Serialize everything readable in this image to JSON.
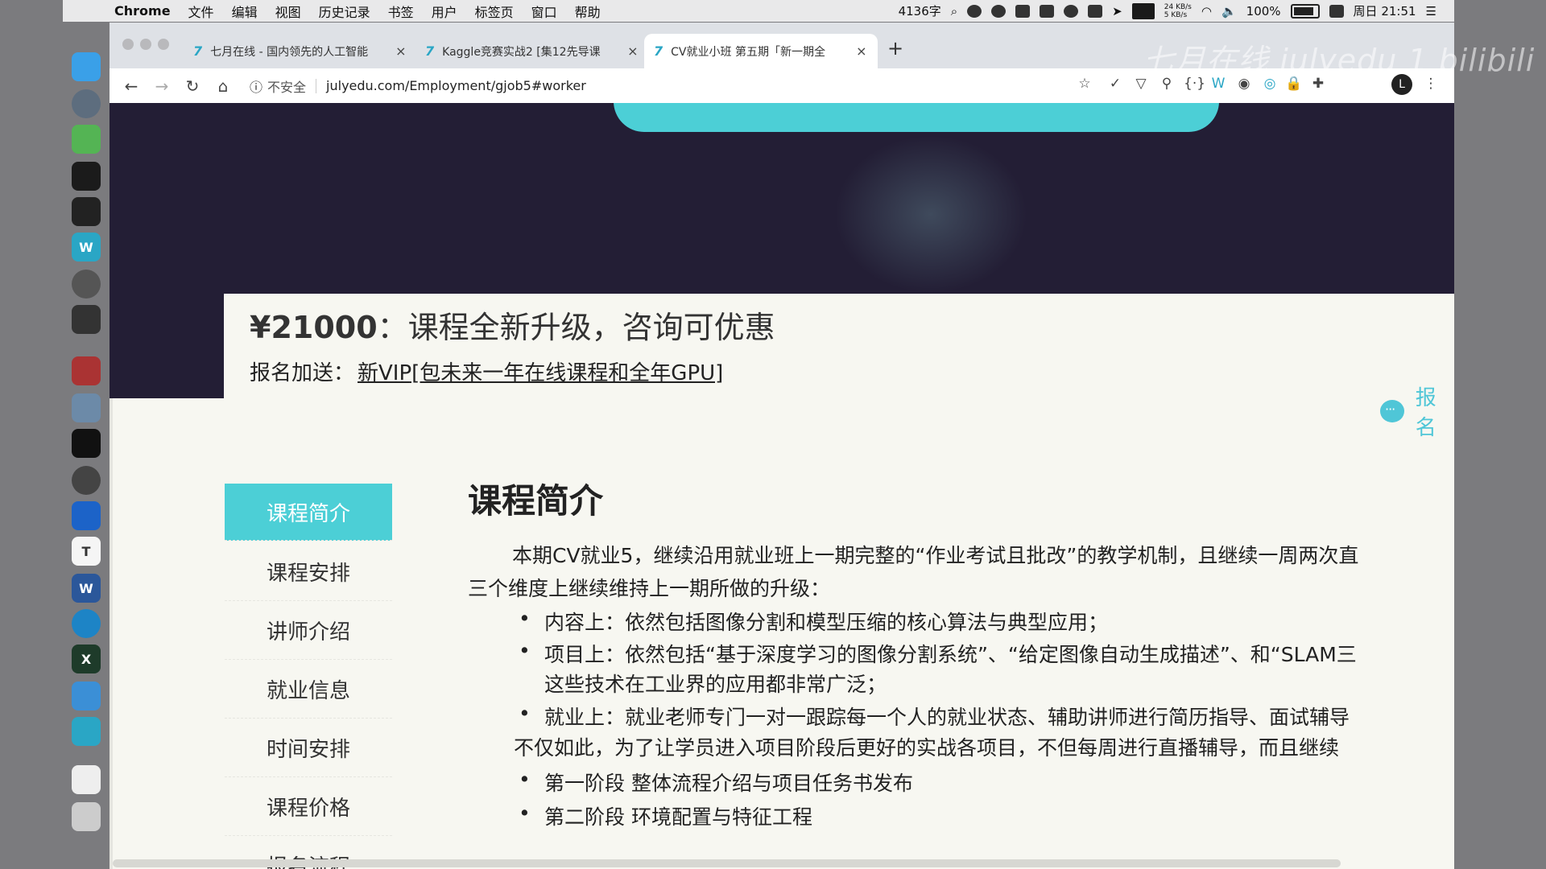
{
  "menubar": {
    "items": [
      "Chrome",
      "文件",
      "编辑",
      "视图",
      "历史记录",
      "书签",
      "用户",
      "标签页",
      "窗口",
      "帮助"
    ],
    "word_count": "4136字",
    "net_up": "24 KB/s",
    "net_down": "5 KB/s",
    "battery": "100%",
    "clock": "周日 21:51"
  },
  "tabs": [
    {
      "title": "七月在线 - 国内领先的人工智能",
      "active": false
    },
    {
      "title": "Kaggle竞赛实战2 [集12先导课",
      "active": false
    },
    {
      "title": "CV就业小班 第五期「新一期全",
      "active": true
    }
  ],
  "toolbar": {
    "security_label": "不安全",
    "url": "julyedu.com/Employment/gjob5#worker",
    "profile_initial": "L"
  },
  "watermark": "七月在线 julyedu 1 bilibili",
  "page": {
    "price": "¥21000",
    "price_desc": "：课程全新升级，咨询可优惠",
    "bonus_label": "报名加送：",
    "bonus_link": "新VIP[包未来一年在线课程和全年GPU]",
    "signup_label": "报名",
    "sidenav": [
      "课程简介",
      "课程安排",
      "讲师介绍",
      "就业信息",
      "时间安排",
      "课程价格",
      "报名流程"
    ],
    "section_title": "课程简介",
    "intro_line1": "本期CV就业5，继续沿用就业班上一期完整的“作业考试且批改”的教学机制，且继续一周两次直",
    "intro_line2": "三个维度上继续维持上一期所做的升级：",
    "bullets": [
      "内容上：依然包括图像分割和模型压缩的核心算法与典型应用；",
      "项目上：依然包括“基于深度学习的图像分割系统”、“给定图像自动生成描述”、和“SLAM三",
      "这些技术在工业界的应用都非常广泛；",
      "就业上：就业老师专门一对一跟踪每一个人的就业状态、辅助讲师进行简历指导、面试辅导"
    ],
    "extra_line": "不仅如此，为了让学员进入项目阶段后更好的实战各项目，不但每周进行直播辅导，而且继续",
    "stages": [
      "第一阶段 整体流程介绍与项目任务书发布",
      "第二阶段 环境配置与特征工程"
    ]
  }
}
